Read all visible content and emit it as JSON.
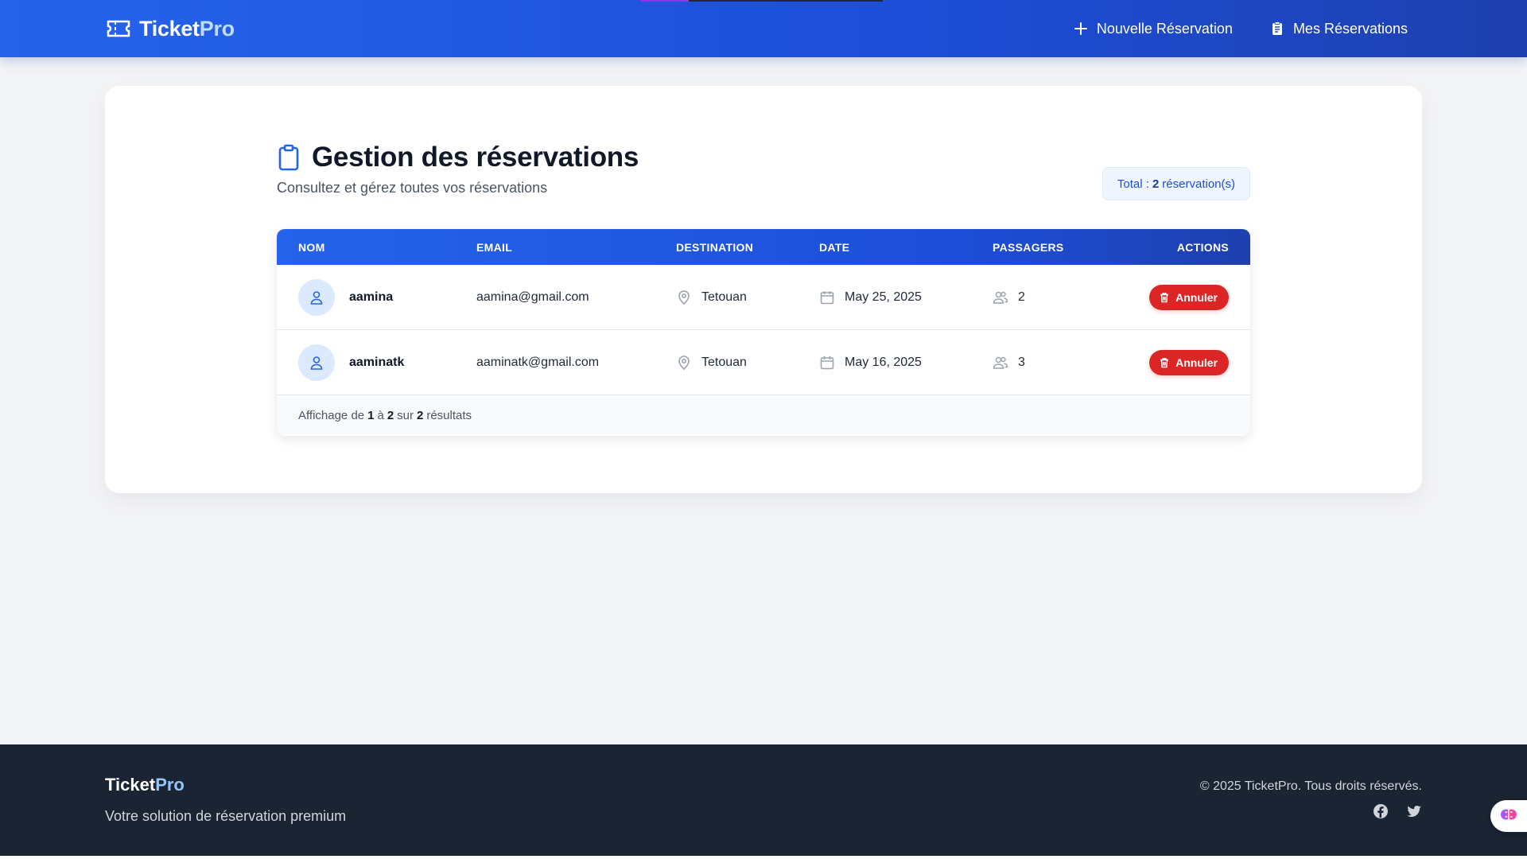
{
  "header": {
    "brand_main": "Ticket",
    "brand_accent": "Pro",
    "nav": [
      {
        "label": "Nouvelle Réservation",
        "icon": "plus-icon"
      },
      {
        "label": "Mes Réservations",
        "icon": "clipboard-list-icon"
      }
    ]
  },
  "page": {
    "title": "Gestion des réservations",
    "subtitle": "Consultez et gérez toutes vos réservations",
    "total_prefix": "Total :",
    "total_count": "2",
    "total_suffix": "réservation(s)"
  },
  "table": {
    "columns": [
      "NOM",
      "EMAIL",
      "DESTINATION",
      "DATE",
      "PASSAGERS",
      "ACTIONS"
    ],
    "rows": [
      {
        "name": "aamina",
        "email": "aamina@gmail.com",
        "destination": "Tetouan",
        "date": "May 25, 2025",
        "passengers": "2",
        "action": "Annuler"
      },
      {
        "name": "aaminatk",
        "email": "aaminatk@gmail.com",
        "destination": "Tetouan",
        "date": "May 16, 2025",
        "passengers": "3",
        "action": "Annuler"
      }
    ],
    "footer": {
      "prefix": "Affichage de",
      "from": "1",
      "mid": "à",
      "to": "2",
      "mid2": "sur",
      "total": "2",
      "suffix": "résultats"
    }
  },
  "footer": {
    "brand_main": "Ticket",
    "brand_accent": "Pro",
    "tagline": "Votre solution de réservation premium",
    "copyright": "© 2025 TicketPro. Tous droits réservés.",
    "socials": [
      "facebook-icon",
      "twitter-icon"
    ]
  },
  "colors": {
    "primary": "#2563eb",
    "danger": "#dc2626",
    "footer_bg": "#1b2433"
  }
}
